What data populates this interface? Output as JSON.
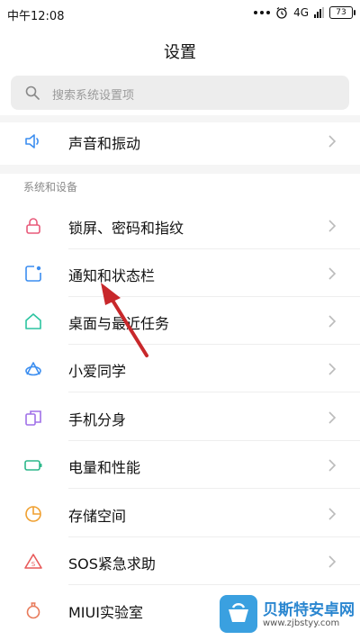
{
  "status_bar": {
    "time": "中午12:08",
    "network": "4G",
    "battery": "73"
  },
  "header": {
    "title": "设置"
  },
  "search": {
    "placeholder": "搜索系统设置项"
  },
  "sound_item": {
    "label": "声音和振动",
    "icon": "speaker-icon"
  },
  "section_system": {
    "header": "系统和设备"
  },
  "system_items": [
    {
      "label": "锁屏、密码和指纹",
      "icon": "lock-icon",
      "color": "#e85a7a"
    },
    {
      "label": "通知和状态栏",
      "icon": "notification-icon",
      "color": "#3c8ef0"
    },
    {
      "label": "桌面与最近任务",
      "icon": "home-icon",
      "color": "#2cc4a0"
    },
    {
      "label": "小爱同学",
      "icon": "xiaoai-icon",
      "color": "#3c8ef0"
    },
    {
      "label": "手机分身",
      "icon": "clone-icon",
      "color": "#a070e8"
    },
    {
      "label": "电量和性能",
      "icon": "battery-icon",
      "color": "#2cb78a"
    },
    {
      "label": "存储空间",
      "icon": "storage-icon",
      "color": "#f0a030"
    },
    {
      "label": "SOS紧急求助",
      "icon": "sos-icon",
      "color": "#e85a5a"
    },
    {
      "label": "MIUI实验室",
      "icon": "flask-icon",
      "color": "#e87a5a"
    }
  ],
  "watermark": {
    "title": "贝斯特安卓网",
    "url": "www.zjbstyy.com"
  }
}
